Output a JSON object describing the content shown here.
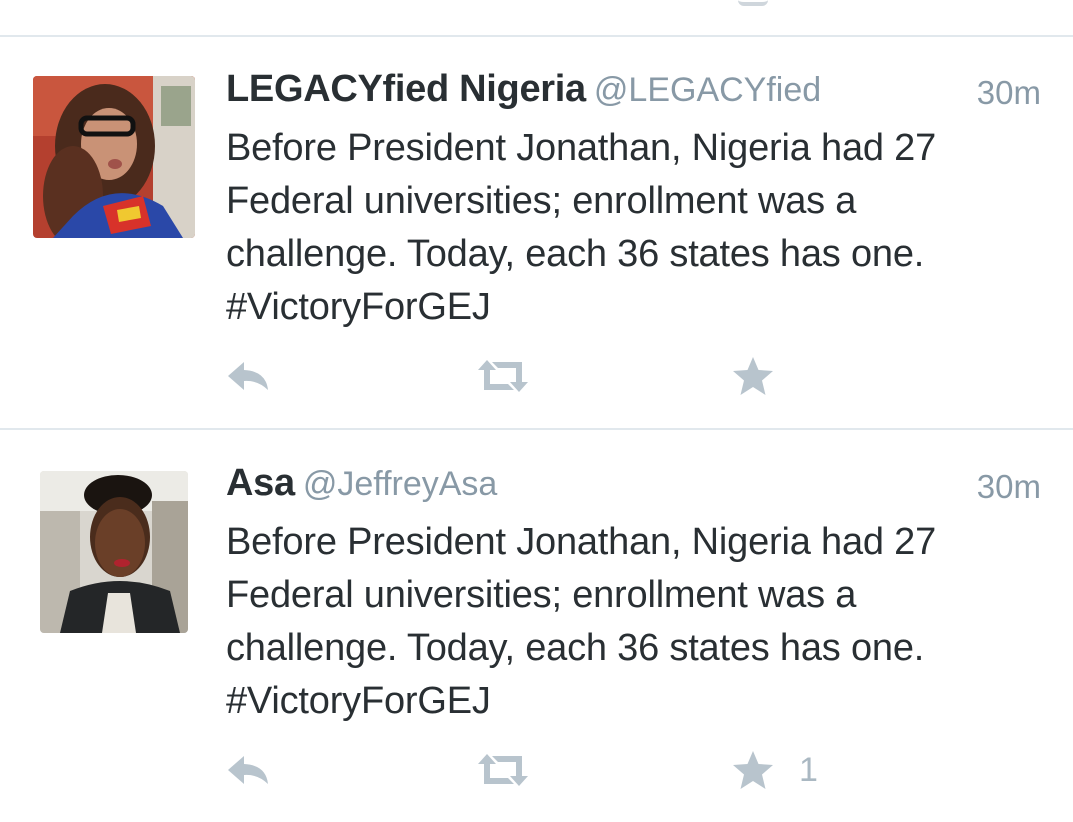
{
  "colors": {
    "name": "#292f33",
    "secondary": "#8899a6",
    "action_icon": "#b8c4cd",
    "divider": "#e1e8ed"
  },
  "tweets": [
    {
      "display_name": "LEGACYfied Nigeria",
      "handle": "@LEGACYfied",
      "time": "30m",
      "text": "Before President Jonathan, Nigeria had 27\nFederal universities; enrollment was a\nchallenge. Today, each 36 states has one.\n#VictoryForGEJ",
      "favorite_count": "",
      "icons": {
        "reply": "reply-icon",
        "retweet": "retweet-icon",
        "favorite": "star-icon"
      }
    },
    {
      "display_name": "Asa",
      "handle": "@JeffreyAsa",
      "time": "30m",
      "text": "Before President Jonathan, Nigeria had 27\nFederal universities; enrollment was a\nchallenge. Today, each 36 states has one.\n#VictoryForGEJ",
      "favorite_count": "1",
      "icons": {
        "reply": "reply-icon",
        "retweet": "retweet-icon",
        "favorite": "star-icon"
      }
    }
  ]
}
